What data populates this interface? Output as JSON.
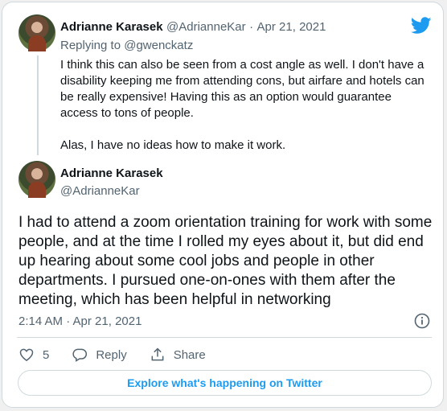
{
  "colors": {
    "accent": "#1d9bf0",
    "muted": "#536471",
    "text": "#0f1419",
    "border": "#cfd9de"
  },
  "reply_tweet": {
    "author_name": "Adrianne Karasek",
    "author_handle": "@AdrianneKar",
    "separator": "·",
    "date": "Apr 21, 2021",
    "replying_prefix": "Replying to",
    "replying_to": "@gwenckatz",
    "paragraphs": [
      "I think this can also be seen from a cost angle as well. I don't have a disability keeping me from attending cons, but airfare and hotels can be really expensive! Having this as an option would guarantee access to tons of people.",
      "Alas, I have no ideas how to make it work."
    ]
  },
  "main_tweet": {
    "author_name": "Adrianne Karasek",
    "author_handle": "@AdrianneKar",
    "text": "I had to attend a zoom orientation training for work with some people, and at the time I rolled my eyes about it, but did end up hearing about some cool jobs and people in other departments. I pursued one-on-ones with them after the meeting, which has been helpful in networking",
    "timestamp": "2:14 AM · Apr 21, 2021"
  },
  "actions": {
    "like_count": "5",
    "reply_label": "Reply",
    "share_label": "Share"
  },
  "explore_button": "Explore what's happening on Twitter",
  "icons": [
    "twitter-logo-icon",
    "info-icon",
    "heart-icon",
    "reply-icon",
    "share-icon"
  ]
}
